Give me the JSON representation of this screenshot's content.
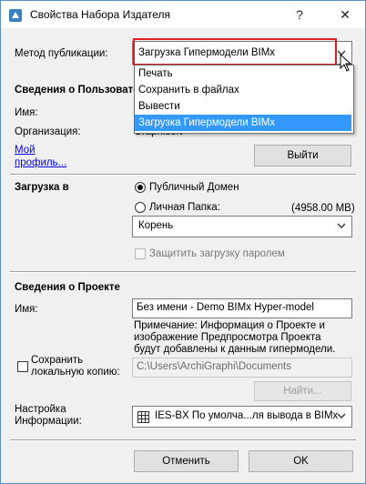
{
  "window": {
    "title": "Свойства Набора Издателя",
    "help": "?",
    "close": "✕"
  },
  "publish": {
    "label": "Метод публикации:",
    "value": "Загрузка Гипермодели BIMx"
  },
  "dropdown": {
    "items": [
      "Печать",
      "Сохранить в файлах",
      "Вывести",
      "Загрузка Гипермодели BIMx"
    ],
    "selected_index": 3
  },
  "user": {
    "heading": "Сведения о Пользовате",
    "name_label": "Имя:",
    "org_label": "Организация:",
    "org_value": "Graphisoft",
    "profile_line1": "Мой",
    "profile_line2": "профиль...",
    "logout_button": "Выйти"
  },
  "upload": {
    "label": "Загрузка в",
    "public_label": "Публичный Домен",
    "private_label": "Личная Папка:",
    "private_size": "(4958.00 MB)",
    "folder_value": "Корень",
    "password_label": "Защитить загрузку паролем"
  },
  "project": {
    "heading": "Сведения о Проекте",
    "name_label": "Имя:",
    "name_value": "Без имени - Demo BIMx Hyper-model",
    "note": [
      "Примечание: Информация о Проекте и",
      "изображение Предпросмотра Проекта",
      "будут добавлены к данным гипермодели."
    ]
  },
  "local_copy": {
    "label_line1": "Сохранить",
    "label_line2": "локальную копию:",
    "path": "C:\\Users\\ArchiGraphi\\Documents",
    "browse_button": "Найти..."
  },
  "settings": {
    "label_line1": "Настройка",
    "label_line2": "Информации:",
    "value": "IES-BX По умолча...ля вывода в BIMx"
  },
  "footer": {
    "cancel": "Отменить",
    "ok": "OK"
  },
  "colors": {
    "highlight_border": "#e02020",
    "selection_bg": "#3399ff",
    "window_border": "#5a8fc7"
  },
  "icons": {
    "app": "app-icon",
    "dropdown_arrow": "chevron-down-icon",
    "settings": "table-icon",
    "cursor": "mouse-cursor-icon"
  }
}
